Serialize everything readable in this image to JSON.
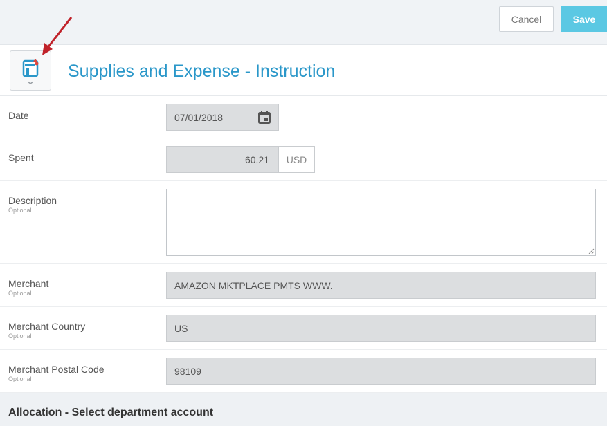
{
  "toolbar": {
    "cancel_label": "Cancel",
    "save_label": "Save"
  },
  "header": {
    "title": "Supplies and Expense - Instruction",
    "icon": "receipt-form-icon"
  },
  "form": {
    "date": {
      "label": "Date",
      "value": "07/01/2018"
    },
    "spent": {
      "label": "Spent",
      "value": "60.21",
      "currency": "USD"
    },
    "description": {
      "label": "Description",
      "optional": "Optional",
      "value": ""
    },
    "merchant": {
      "label": "Merchant",
      "optional": "Optional",
      "value": "AMAZON MKTPLACE PMTS WWW."
    },
    "merchant_country": {
      "label": "Merchant Country",
      "optional": "Optional",
      "value": "US"
    },
    "merchant_postal": {
      "label": "Merchant Postal Code",
      "optional": "Optional",
      "value": "98109"
    }
  },
  "allocation": {
    "title": "Allocation - Select department account"
  },
  "colors": {
    "accent": "#5bc8e3",
    "title": "#2a97c9",
    "annotation_arrow": "#c0222a"
  }
}
